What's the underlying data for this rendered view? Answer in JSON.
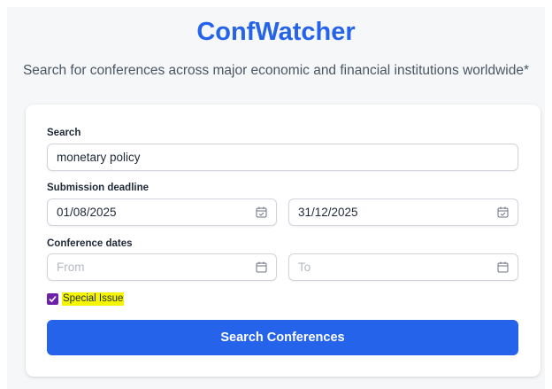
{
  "header": {
    "title": "ConfWatcher",
    "subtitle": "Search for conferences across major economic and financial institutions worldwide*"
  },
  "form": {
    "search": {
      "label": "Search",
      "value": "monetary policy"
    },
    "submission_deadline": {
      "label": "Submission deadline",
      "from_value": "01/08/2025",
      "to_value": "31/12/2025"
    },
    "conference_dates": {
      "label": "Conference dates",
      "from_placeholder": "From",
      "to_placeholder": "To"
    },
    "special_issue": {
      "label": "Special Issue",
      "checked": true
    },
    "submit_label": "Search Conferences"
  },
  "colors": {
    "accent": "#2563eb",
    "checkbox": "#6b21a8",
    "highlight": "#f5f500"
  },
  "icons": [
    "calendar-check-icon",
    "calendar-icon",
    "checkmark-icon"
  ]
}
